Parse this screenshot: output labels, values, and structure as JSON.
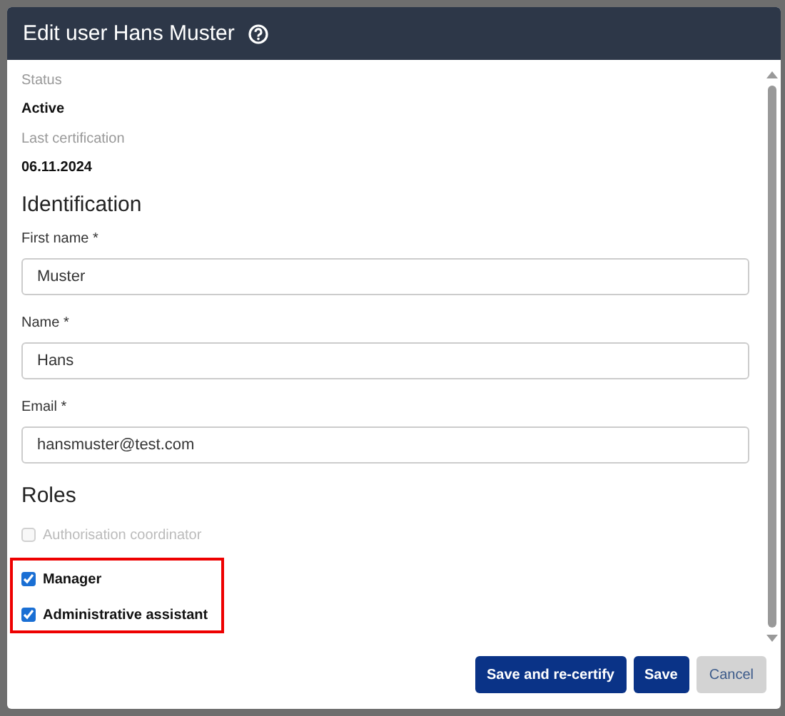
{
  "dialog": {
    "title": "Edit user Hans Muster"
  },
  "info": [
    {
      "label": "Status",
      "value": "Active"
    },
    {
      "label": "Last certification",
      "value": "06.11.2024"
    }
  ],
  "identification": {
    "heading": "Identification",
    "fields": [
      {
        "label": "First name *",
        "value": "Muster"
      },
      {
        "label": "Name *",
        "value": "Hans"
      },
      {
        "label": "Email *",
        "value": "hansmuster@test.com"
      }
    ]
  },
  "roles": {
    "heading": "Roles",
    "items": [
      {
        "label": "Authorisation coordinator",
        "checked": false,
        "disabled": true,
        "highlighted": false
      },
      {
        "label": "Manager",
        "checked": true,
        "disabled": false,
        "highlighted": true
      },
      {
        "label": "Administrative assistant",
        "checked": true,
        "disabled": false,
        "highlighted": true
      }
    ]
  },
  "buttons": [
    {
      "label": "Save and re-certify",
      "kind": "primary"
    },
    {
      "label": "Save",
      "kind": "primary"
    },
    {
      "label": "Cancel",
      "kind": "secondary"
    }
  ]
}
